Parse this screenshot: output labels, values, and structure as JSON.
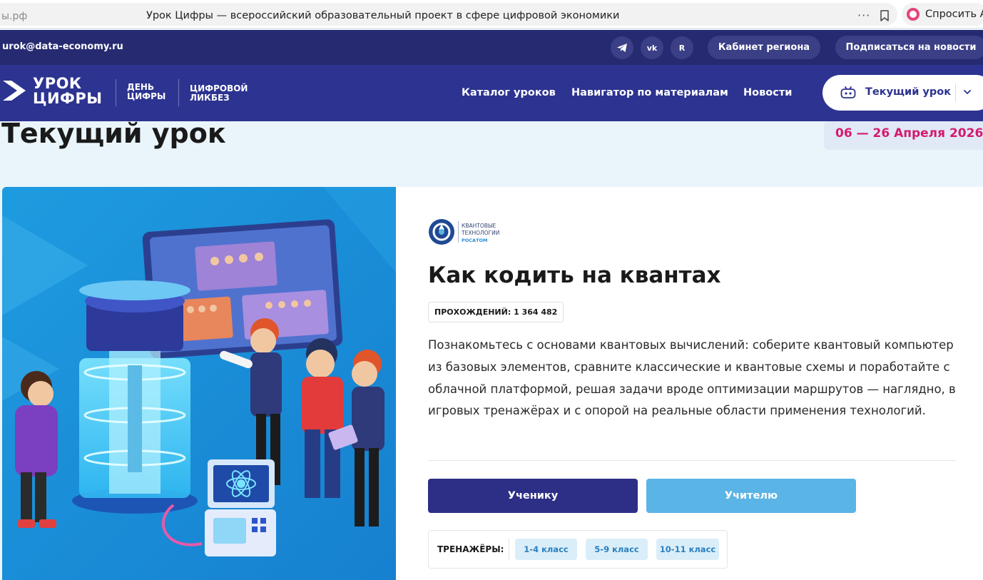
{
  "browser": {
    "domain": "ы.рф",
    "tab_title": "Урок Цифры — всероссийский образовательный проект в сфере цифровой экономики",
    "more": "···",
    "ask_label": "Спросить А"
  },
  "topbar": {
    "email": "urok@data-economy.ru",
    "social": [
      {
        "name": "telegram",
        "icon": "telegram-icon"
      },
      {
        "name": "vk",
        "icon": "vk-icon",
        "glyph": "vk"
      },
      {
        "name": "rutube",
        "icon": "rutube-icon",
        "glyph": "R"
      }
    ],
    "region_cabinet": "Кабинет региона",
    "subscribe": "Подписаться на новости"
  },
  "header": {
    "logo_line1": "УРОК",
    "logo_line2": "ЦИФРЫ",
    "sub1_line1": "ДЕНЬ",
    "sub1_line2": "ЦИФРЫ",
    "sub2_line1": "ЦИФРОВОЙ",
    "sub2_line2": "ЛИКБЕЗ",
    "nav": [
      "Каталог уроков",
      "Навигатор по материалам",
      "Новости"
    ],
    "current_lesson": "Текущий урок"
  },
  "hero": {
    "title": "Текущий урок",
    "dates": "06 — 26 Апреля 2026"
  },
  "lesson": {
    "partner_line1": "КВАНТОВЫЕ",
    "partner_line2": "ТЕХНОЛОГИИ",
    "partner_line3": "РОСАТОМ",
    "title": "Как кодить на квантах",
    "passes": "ПРОХОЖДЕНИЙ: 1 364 482",
    "description": "Познакомьтесь с основами квантовых вычислений: соберите квантовый компьютер из базовых элементов, сравните классические и квантовые схемы и поработайте с облачной платформой, решая задачи вроде оптимизации маршрутов — наглядно, в игровых тренажёрах и с опорой на реальные области применения технологий.",
    "student_button": "Ученику",
    "teacher_button": "Учителю",
    "trainers_label": "ТРЕНАЖЁРЫ:",
    "grades": [
      "1-4 класс",
      "5-9 класс",
      "10-11 класс"
    ]
  },
  "colors": {
    "navy": "#262b71",
    "header": "#2c3390",
    "pink": "#d41a6e",
    "light_blue": "#5bb4e6"
  }
}
